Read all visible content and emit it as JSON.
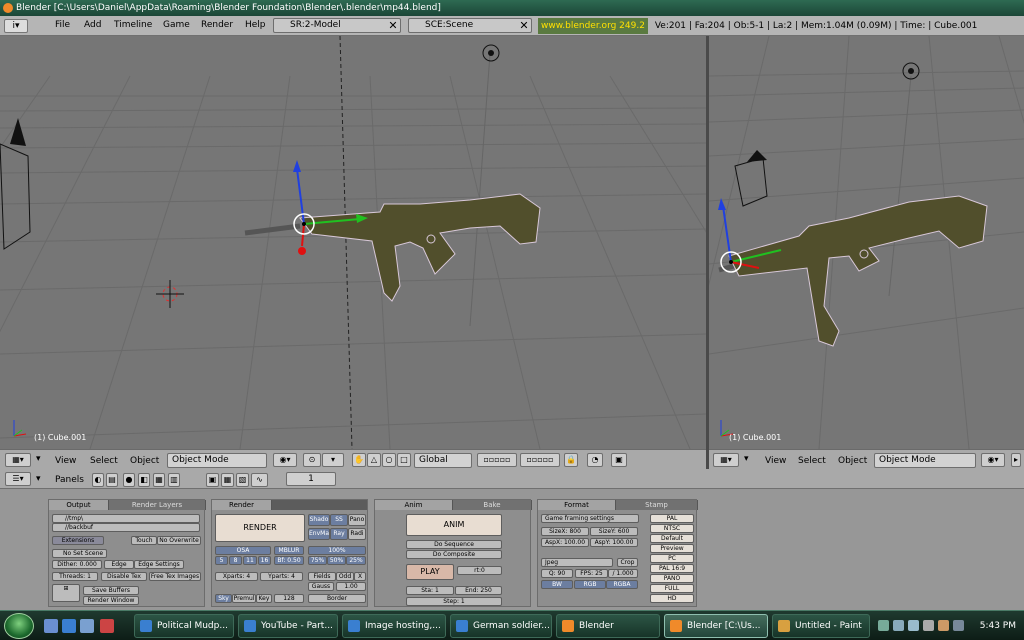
{
  "window": {
    "title": "Blender [C:\\Users\\Daniel\\AppData\\Roaming\\Blender Foundation\\Blender\\.blender\\mp44.blend]"
  },
  "info_header": {
    "menus": [
      "File",
      "Add",
      "Timeline",
      "Game",
      "Render",
      "Help"
    ],
    "screen": "SR:2-Model",
    "scene": "SCE:Scene",
    "url": "www.blender.org 249.2",
    "stats": "Ve:201 | Fa:204 | Ob:5-1 | La:2 | Mem:1.04M (0.09M) | Time: | Cube.001"
  },
  "viewport_left": {
    "object_label": "(1) Cube.001",
    "header": {
      "menus": [
        "View",
        "Select",
        "Object"
      ],
      "mode": "Object Mode",
      "orientation": "Global"
    }
  },
  "viewport_right": {
    "object_label": "(1) Cube.001",
    "header": {
      "menus": [
        "View",
        "Select",
        "Object"
      ],
      "mode": "Object Mode"
    }
  },
  "buttons_window": {
    "panels_label": "Panels",
    "frame": "1",
    "output": {
      "tabs": [
        "Output",
        "Render Layers"
      ],
      "path1": "//tmp\\",
      "path2": "//backbuf",
      "buttons": [
        "Extensions",
        "Touch",
        "No Overwrite",
        "No Set Scene",
        "Dither: 0.000",
        "Edge",
        "Edge Settings",
        "Threads: 1",
        "Disable Tex",
        "Free Tex Images",
        "Save Buffers",
        "Render Window"
      ]
    },
    "render": {
      "tabs": [
        "Render"
      ],
      "render_label": "RENDER",
      "buttons": [
        "Shado",
        "SS",
        "Pano",
        "EnvMa",
        "Ray",
        "Radi",
        "OSA",
        "MBLUR",
        "100%",
        "5",
        "8",
        "11",
        "16",
        "Bf: 0.50",
        "75%",
        "50%",
        "25%",
        "Xparts: 4",
        "Yparts: 4",
        "Fields",
        "Odd",
        "X",
        "Gauss",
        "1.00",
        "Sky",
        "Premul",
        "Key",
        "128",
        "Border"
      ]
    },
    "anim": {
      "tabs": [
        "Anim",
        "Bake"
      ],
      "anim_label": "ANIM",
      "buttons": [
        "Do Sequence",
        "Do Composite"
      ],
      "play_label": "PLAY",
      "rt": "rt:0",
      "sta": "Sta: 1",
      "end": "End: 250",
      "step": "Step: 1"
    },
    "format": {
      "tabs": [
        "Format",
        "Stamp"
      ],
      "game_framing": "Game framing settings",
      "sizex": "SizeX: 800",
      "sizey": "SizeY: 600",
      "aspx": "AspX: 100.00",
      "aspy": "AspY: 100.00",
      "codec": "Jpeg",
      "crop": "Crop",
      "quality": "Q: 90",
      "fps": "FPS: 25",
      "fps_base": "/ 1.000",
      "bw": "BW",
      "rgb": "RGB",
      "rgba": "RGBA",
      "presets": [
        "PAL",
        "NTSC",
        "Default",
        "Preview",
        "PC",
        "PAL 16:9",
        "PANO",
        "FULL",
        "HD"
      ]
    }
  },
  "taskbar": {
    "tasks": [
      {
        "label": "Political Mudp...",
        "color": "#3a7fd0"
      },
      {
        "label": "YouTube - Part...",
        "color": "#3a7fd0"
      },
      {
        "label": "Image hosting,...",
        "color": "#3a7fd0"
      },
      {
        "label": "German soldier...",
        "color": "#3a7fd0"
      },
      {
        "label": "Blender",
        "color": "#f08a2a"
      },
      {
        "label": "Blender [C:\\Us...",
        "color": "#f08a2a"
      },
      {
        "label": "Untitled - Paint",
        "color": "#d8a040"
      }
    ],
    "clock": "5:43 PM"
  }
}
